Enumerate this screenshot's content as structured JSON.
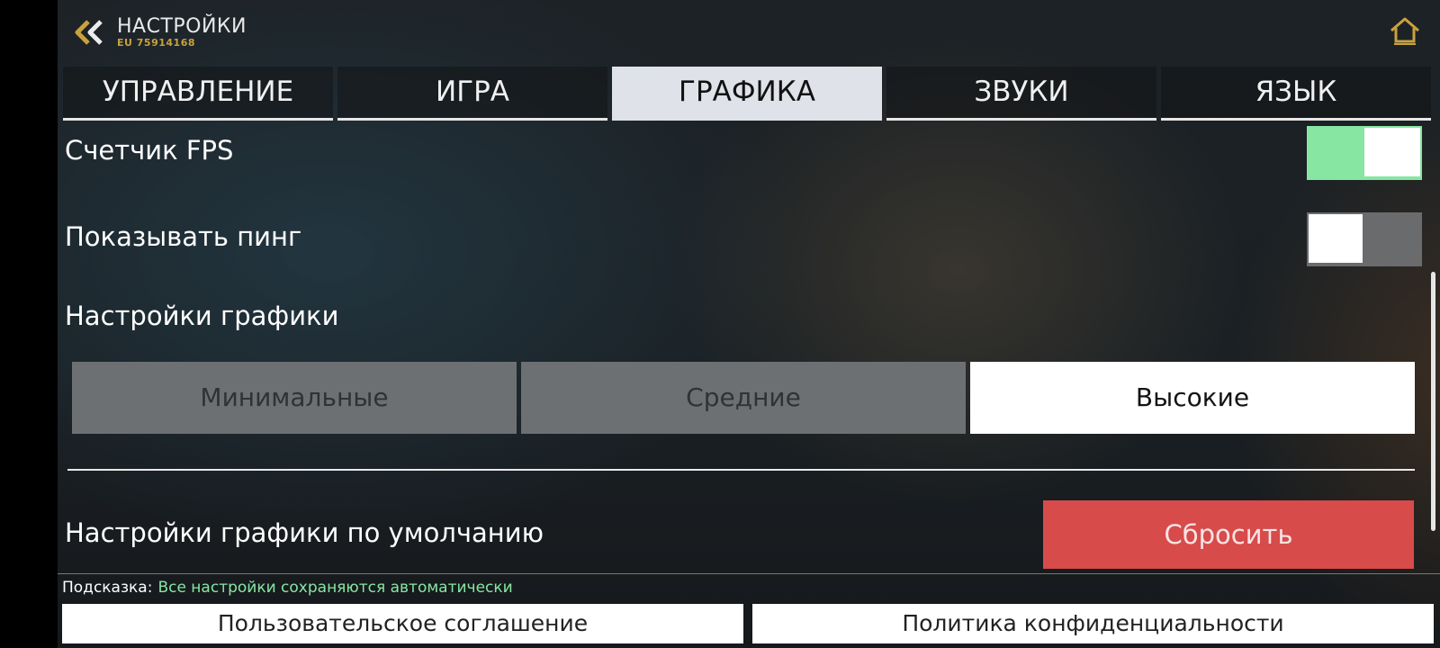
{
  "header": {
    "title": "НАСТРОЙКИ",
    "player_id": "EU 75914168",
    "back_icon": "double-chevron-left-icon",
    "home_icon": "home-icon"
  },
  "tabs": [
    {
      "label": "УПРАВЛЕНИЕ",
      "active": false
    },
    {
      "label": "ИГРА",
      "active": false
    },
    {
      "label": "ГРАФИКА",
      "active": true
    },
    {
      "label": "ЗВУКИ",
      "active": false
    },
    {
      "label": "ЯЗЫК",
      "active": false
    }
  ],
  "settings": {
    "fps_counter": {
      "label": "Счетчик FPS",
      "enabled": true
    },
    "show_ping": {
      "label": "Показывать пинг",
      "enabled": false
    },
    "graphics": {
      "label": "Настройки графики",
      "options": [
        "Минимальные",
        "Средние",
        "Высокие"
      ],
      "selected": "Высокие"
    },
    "defaults": {
      "label": "Настройки графики по умолчанию",
      "reset_label": "Сбросить"
    }
  },
  "footer": {
    "hint_label": "Подсказка:",
    "hint_text": "Все настройки сохраняются автоматически",
    "user_agreement": "Пользовательское соглашение",
    "privacy_policy": "Политика конфиденциальности"
  },
  "colors": {
    "accent_green": "#86e6a2",
    "reset_red": "#d84b4b",
    "id_gold": "#c9a23c"
  }
}
